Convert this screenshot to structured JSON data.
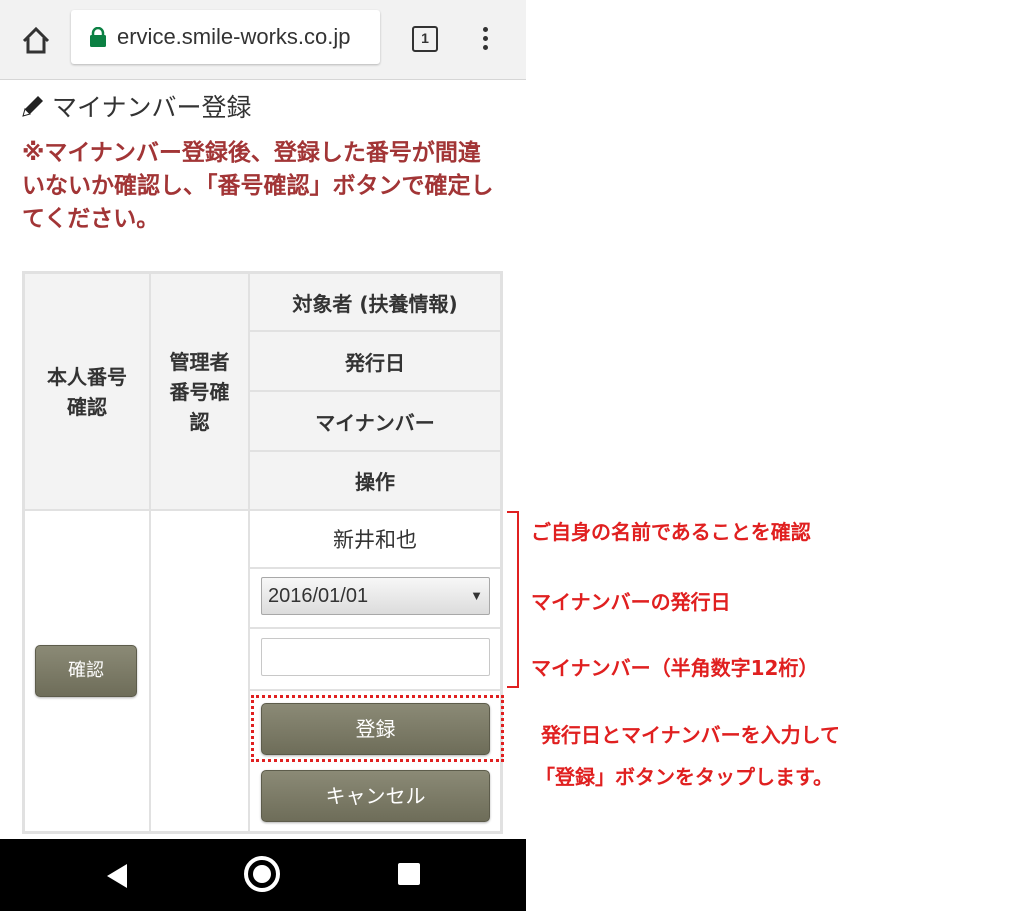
{
  "browser": {
    "url": "ervice.smile-works.co.jp",
    "tab_count": "1",
    "icons": [
      "home-icon",
      "lock-icon",
      "tabs-icon",
      "overflow-menu-icon"
    ]
  },
  "page": {
    "title": "マイナンバー登録",
    "title_icon": "pencil-icon",
    "notice": "※マイナンバー登録後、登録した番号が間違いないか確認し、「番号確認」ボタンで確定してください。"
  },
  "table": {
    "headers": {
      "self_check": "本人番号確認",
      "admin_check": "管理者番号確認",
      "target": "対象者 (扶養情報)",
      "issue_date": "発行日",
      "my_number": "マイナンバー",
      "operation": "操作"
    },
    "row": {
      "name": "新井和也",
      "issue_date_value": "2016/01/01",
      "my_number_value": "",
      "self_check_button": "確認",
      "register_button": "登録",
      "cancel_button": "キャンセル"
    }
  },
  "annotations": {
    "confirm_name": "ご自身の名前であることを確認",
    "issue_date_note": "マイナンバーの発行日",
    "my_number_note": "マイナンバー（半角数字12桁）",
    "instruction_line1": "発行日とマイナンバーを入力して",
    "instruction_line2": "「登録」ボタンをタップします。"
  },
  "colors": {
    "notice": "#a23536",
    "annotation": "#e02020",
    "button": "#7b7a66"
  },
  "navbar": {
    "icons": [
      "back-icon",
      "home-circle-icon",
      "recent-apps-icon"
    ]
  }
}
